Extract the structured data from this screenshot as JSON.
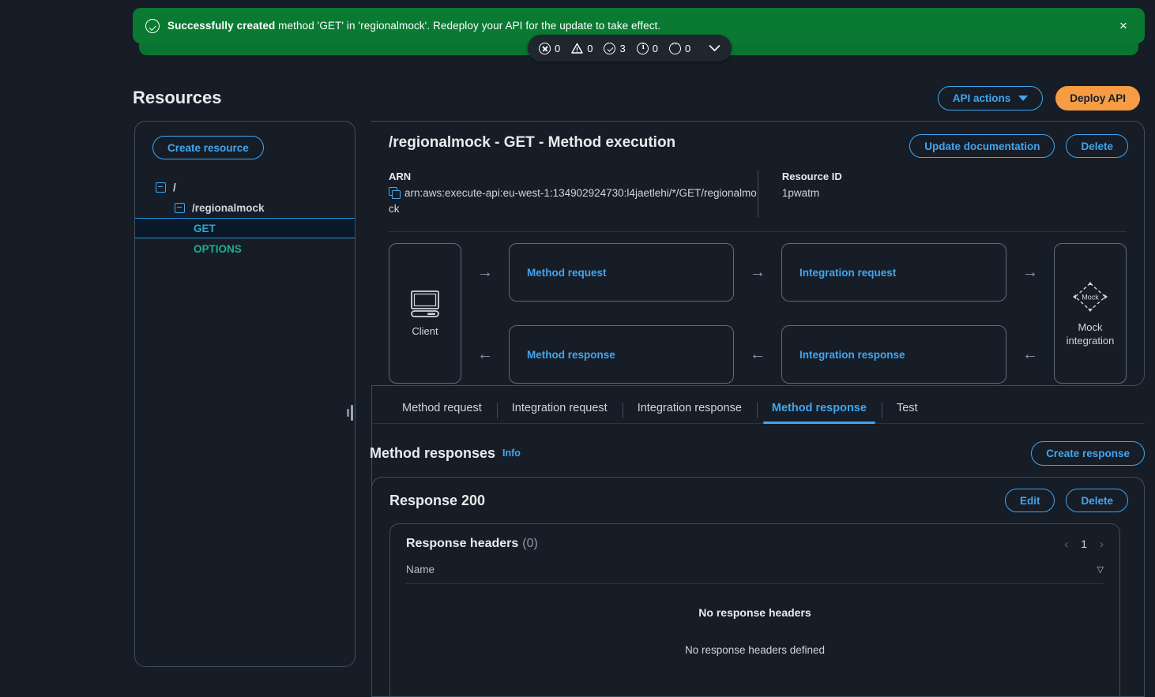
{
  "flash": {
    "bold": "Successfully created",
    "rest": " method 'GET' in 'regionalmock'. Redeploy your API for the update to take effect.",
    "close_label": "×"
  },
  "status_pill": {
    "items": [
      {
        "icon": "error-icon",
        "count": "0"
      },
      {
        "icon": "warning-icon",
        "count": "0"
      },
      {
        "icon": "success-icon",
        "count": "3"
      },
      {
        "icon": "info-icon",
        "count": "0"
      },
      {
        "icon": "pending-icon",
        "count": "0"
      }
    ],
    "expand_icon": "chevron-down-icon"
  },
  "header": {
    "title": "Resources",
    "api_actions_label": "API actions",
    "deploy_label": "Deploy API"
  },
  "tree": {
    "create_label": "Create resource",
    "root": "/",
    "resource": "/regionalmock",
    "methods": [
      {
        "label": "GET",
        "selected": true
      },
      {
        "label": "OPTIONS",
        "selected": false
      }
    ]
  },
  "method_panel": {
    "title": "/regionalmock - GET - Method execution",
    "update_doc_label": "Update documentation",
    "delete_label": "Delete",
    "arn_label": "ARN",
    "arn_value": "arn:aws:execute-api:eu-west-1:134902924730:l4jaetlehi/*/GET/regionalmock",
    "resource_id_label": "Resource ID",
    "resource_id_value": "1pwatm"
  },
  "flow": {
    "client_label": "Client",
    "method_request": "Method request",
    "method_response": "Method response",
    "integration_request": "Integration request",
    "integration_response": "Integration response",
    "mock_badge": "Mock",
    "integration_label": "Mock integration"
  },
  "tabs": [
    {
      "label": "Method request",
      "active": false
    },
    {
      "label": "Integration request",
      "active": false
    },
    {
      "label": "Integration response",
      "active": false
    },
    {
      "label": "Method response",
      "active": true
    },
    {
      "label": "Test",
      "active": false
    }
  ],
  "method_responses": {
    "title": "Method responses",
    "info_label": "Info",
    "create_label": "Create response"
  },
  "response_card": {
    "title": "Response 200",
    "edit_label": "Edit",
    "delete_label": "Delete",
    "headers_title": "Response headers",
    "headers_count": "(0)",
    "page_number": "1",
    "column_name": "Name",
    "empty_title": "No response headers",
    "empty_sub": "No response headers defined"
  },
  "colors": {
    "banner_green": "#0a7a33",
    "accent_blue": "#42a5ef",
    "deploy_orange": "#f89c43",
    "get_teal": "#2ea8c4",
    "options_green": "#1fae8f",
    "background": "#161d26"
  }
}
